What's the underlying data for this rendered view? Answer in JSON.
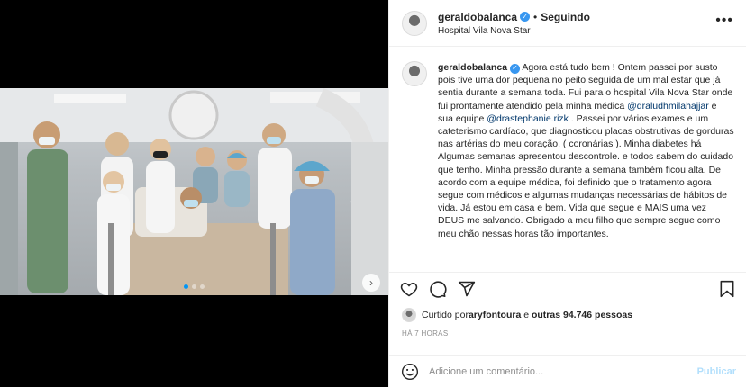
{
  "post": {
    "username": "geraldobalanca",
    "verified_mark": "✓",
    "separator": "•",
    "follow_status": "Seguindo",
    "location": "Hospital Vila Nova Star",
    "more_icon": "•••",
    "next_icon": "›"
  },
  "caption": {
    "username": "geraldobalanca",
    "part1": " Agora está tudo bem ! Ontem passei por susto pois tive uma dor pequena no peito seguida de um mal estar que já sentia durante a semana toda. Fui para o hospital Vila Nova Star onde fui prontamente atendido pela minha médica ",
    "mention1": "@draludhmilahajjar",
    "part2": " e sua equipe ",
    "mention2": "@drastephanie.rizk",
    "part3": " . Passei por vários exames e um cateterismo cardíaco, que diagnosticou placas obstrutivas de gorduras nas artérias do meu coração. ( coronárias ). Minha diabetes há Algumas semanas apresentou descontrole. e todos sabem do cuidado que tenho. Minha pressão durante a semana também ficou alta. De acordo com a equipe médica, foi definido que o tratamento agora segue com médicos e algumas mudanças necessárias de hábitos de vida. Já estou em casa e bem. Vida que segue e MAIS uma vez DEUS me salvando. Obrigado a meu filho que sempre segue como meu chão nessas horas tão importantes."
  },
  "likes": {
    "prefix": "Curtido por ",
    "user": "aryfontoura",
    "middle": " e ",
    "others": "outras 94.746 pessoas"
  },
  "time": "HÁ 7 HORAS",
  "comment": {
    "placeholder": "Adicione um comentário...",
    "publish": "Publicar"
  },
  "carousel": {
    "count": 3,
    "active_index": 0
  },
  "icons": [
    "heart-icon",
    "comment-icon",
    "share-icon",
    "bookmark-icon",
    "emoji-icon",
    "verified-icon",
    "more-options-icon",
    "chevron-right-icon"
  ],
  "colors": {
    "verified": "#3897f0",
    "mention": "#00376b",
    "publish_disabled": "#b2dffc",
    "carousel_active": "#0095f6"
  }
}
